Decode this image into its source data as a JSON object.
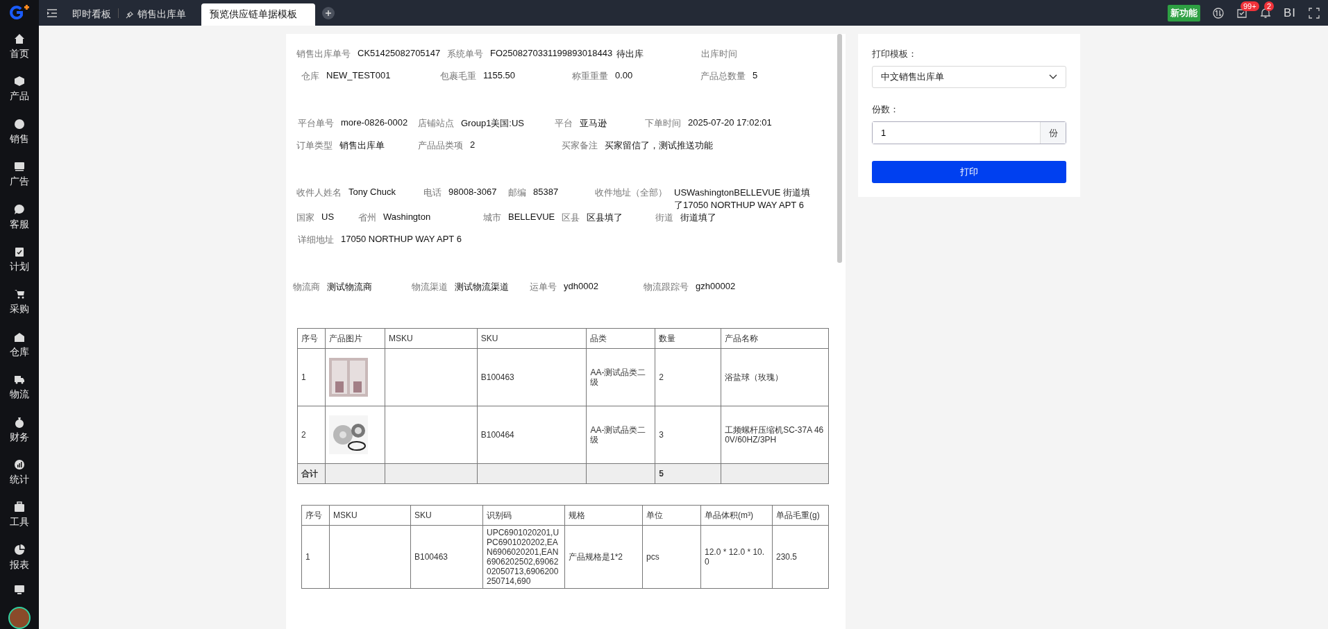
{
  "sidebar": {
    "items": [
      {
        "label": "首页"
      },
      {
        "label": "产品"
      },
      {
        "label": "销售"
      },
      {
        "label": "广告"
      },
      {
        "label": "客服"
      },
      {
        "label": "计划"
      },
      {
        "label": "采购"
      },
      {
        "label": "仓库"
      },
      {
        "label": "物流"
      },
      {
        "label": "财务"
      },
      {
        "label": "统计"
      },
      {
        "label": "工具"
      },
      {
        "label": "报表"
      }
    ]
  },
  "top_bar": {
    "tabs": [
      {
        "label": "即时看板",
        "selected": false,
        "pinned": false
      },
      {
        "label": "销售出库单",
        "selected": false,
        "pinned": true
      },
      {
        "label": "预览供应链单据模板",
        "selected": true,
        "pinned": false
      }
    ],
    "new_feature": "新功能",
    "inbox_badge": "99+",
    "bell_badge": "2",
    "bi": "BI"
  },
  "document": {
    "sections": [
      {
        "rows": [
          [
            {
              "label": "销售出库单号",
              "value": "CK51425082705147"
            },
            {
              "label": "系统单号",
              "value": "FO2508270331199893018443"
            },
            {
              "value": "待出库"
            },
            {
              "label": "出库时间"
            }
          ],
          [
            {
              "label": "仓库",
              "value": "NEW_TEST001"
            },
            {
              "label": "包裹毛重",
              "value": "1155.50"
            },
            {
              "label": "称重重量",
              "value": "0.00"
            },
            {
              "label": "产品总数量",
              "value": "5"
            }
          ]
        ]
      },
      {
        "rows": [
          [
            {
              "label": "平台单号",
              "value": "more-0826-0002"
            },
            {
              "label": "店铺站点",
              "value": "Group1美国:US"
            },
            {
              "label": "平台",
              "value": "亚马逊"
            },
            {
              "label": "下单时间",
              "value": "2025-07-20 17:02:01"
            }
          ],
          [
            {
              "label": "订单类型",
              "value": "销售出库单"
            },
            {
              "label": "产品品类项",
              "value": "2"
            },
            {
              "label": "买家备注",
              "value": "买家留信了，测试推送功能"
            }
          ]
        ]
      },
      {
        "rows": [
          [
            {
              "label": "收件人姓名",
              "value": "Tony Chuck"
            },
            {
              "label": "电话",
              "value": "98008-3067"
            },
            {
              "label": "邮编",
              "value": "85387"
            },
            {
              "label": "收件地址（全部）",
              "value": "USWashingtonBELLEVUE 街道填了17050 NORTHUP WAY APT 6"
            }
          ],
          [
            {
              "label": "国家",
              "value": "US"
            },
            {
              "label": "省州",
              "value": "Washington"
            },
            {
              "label": "城市",
              "value": "BELLEVUE"
            },
            {
              "label": "区县",
              "value": "区县填了"
            },
            {
              "label": "街道",
              "value": "街道填了"
            }
          ],
          [
            {
              "label": "详细地址",
              "value": "17050 NORTHUP WAY APT 6"
            }
          ]
        ]
      },
      {
        "rows": [
          [
            {
              "label": "物流商",
              "value": "测试物流商"
            },
            {
              "label": "物流渠道",
              "value": "测试物流渠道"
            },
            {
              "label": "运单号",
              "value": "ydh0002"
            },
            {
              "label": "物流跟踪号",
              "value": "gzh00002"
            }
          ]
        ]
      }
    ],
    "tables": [
      {
        "columns": [
          {
            "label": "序号",
            "kind": "text"
          },
          {
            "label": "产品图片",
            "kind": "image"
          },
          {
            "label": "MSKU",
            "kind": "text"
          },
          {
            "label": "SKU",
            "kind": "text"
          },
          {
            "label": "品类",
            "kind": "text"
          },
          {
            "label": "数量",
            "kind": "text"
          },
          {
            "label": "产品名称",
            "kind": "text"
          }
        ],
        "rows": [
          {
            "kind": "item",
            "cells": [
              "1",
              null,
              null,
              "B100463",
              "AA-测试品类二级",
              "2",
              "浴盐球（玫瑰）"
            ]
          },
          {
            "kind": "item",
            "cells": [
              "2",
              null,
              null,
              "B100464",
              "AA-测试品类二级",
              "3",
              "工频螺杆压缩机SC-37A 460V/60HZ/3PH"
            ]
          },
          {
            "kind": "total",
            "cells": [
              "合计",
              null,
              null,
              null,
              null,
              "5",
              null
            ]
          }
        ]
      },
      {
        "columns": [
          {
            "label": "序号",
            "kind": "text"
          },
          {
            "label": "MSKU",
            "kind": "text"
          },
          {
            "label": "SKU",
            "kind": "text"
          },
          {
            "label": "识别码",
            "kind": "text"
          },
          {
            "label": "规格",
            "kind": "text"
          },
          {
            "label": "单位",
            "kind": "text"
          },
          {
            "label": "单品体积(m³)",
            "kind": "text"
          },
          {
            "label": "单品毛重(g)",
            "kind": "text"
          }
        ],
        "rows": [
          {
            "kind": "item",
            "cells": [
              "1",
              null,
              "B100463",
              "UPC6901020201,UPC6901020202,EAN6906020201,EAN6906202502,6906202050713,6906200250714,690",
              "产品规格是1*2",
              "pcs",
              "12.0 * 12.0 * 10.0",
              "230.5"
            ]
          }
        ]
      }
    ]
  },
  "print_panel": {
    "template_label": "打印模板：",
    "template_value": "中文销售出库单",
    "copies_label": "份数：",
    "copies_value": "1",
    "copies_suffix": "份",
    "print_button": "打印"
  }
}
